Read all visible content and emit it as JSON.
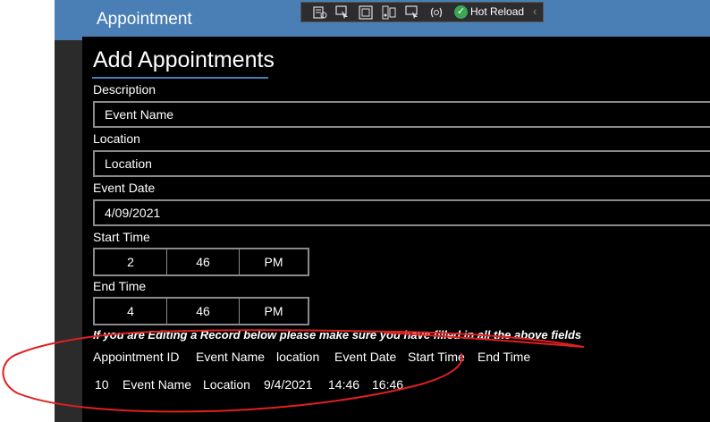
{
  "window": {
    "title": "Appointment"
  },
  "toolbar": {
    "hot_reload_label": "Hot Reload",
    "icons": [
      "live-visual-tree-icon",
      "select-element-icon",
      "display-layout-adorners-icon",
      "track-focus-icon",
      "in-app-selection-icon",
      "binding-failures-icon"
    ]
  },
  "page": {
    "heading": "Add Appointments"
  },
  "form": {
    "description": {
      "label": "Description",
      "value": "Event Name"
    },
    "location": {
      "label": "Location",
      "value": "Location"
    },
    "event_date": {
      "label": "Event Date",
      "value": "4/09/2021"
    },
    "start_time": {
      "label": "Start Time",
      "hour": "2",
      "minute": "46",
      "period": "PM"
    },
    "end_time": {
      "label": "End Time",
      "hour": "4",
      "minute": "46",
      "period": "PM"
    }
  },
  "notice": "If you are Editing a Record below please make sure you have filled in all the above fields",
  "table": {
    "headers": [
      "Appointment ID",
      "Event Name",
      "location",
      "Event Date",
      "Start Time",
      "End Time"
    ],
    "rows": [
      [
        "10",
        "Event Name",
        "Location",
        "9/4/2021",
        "14:46",
        "16:46"
      ]
    ]
  },
  "colors": {
    "titlebar": "#4a7fb5",
    "background": "#000000",
    "annotation": "#e02020"
  }
}
